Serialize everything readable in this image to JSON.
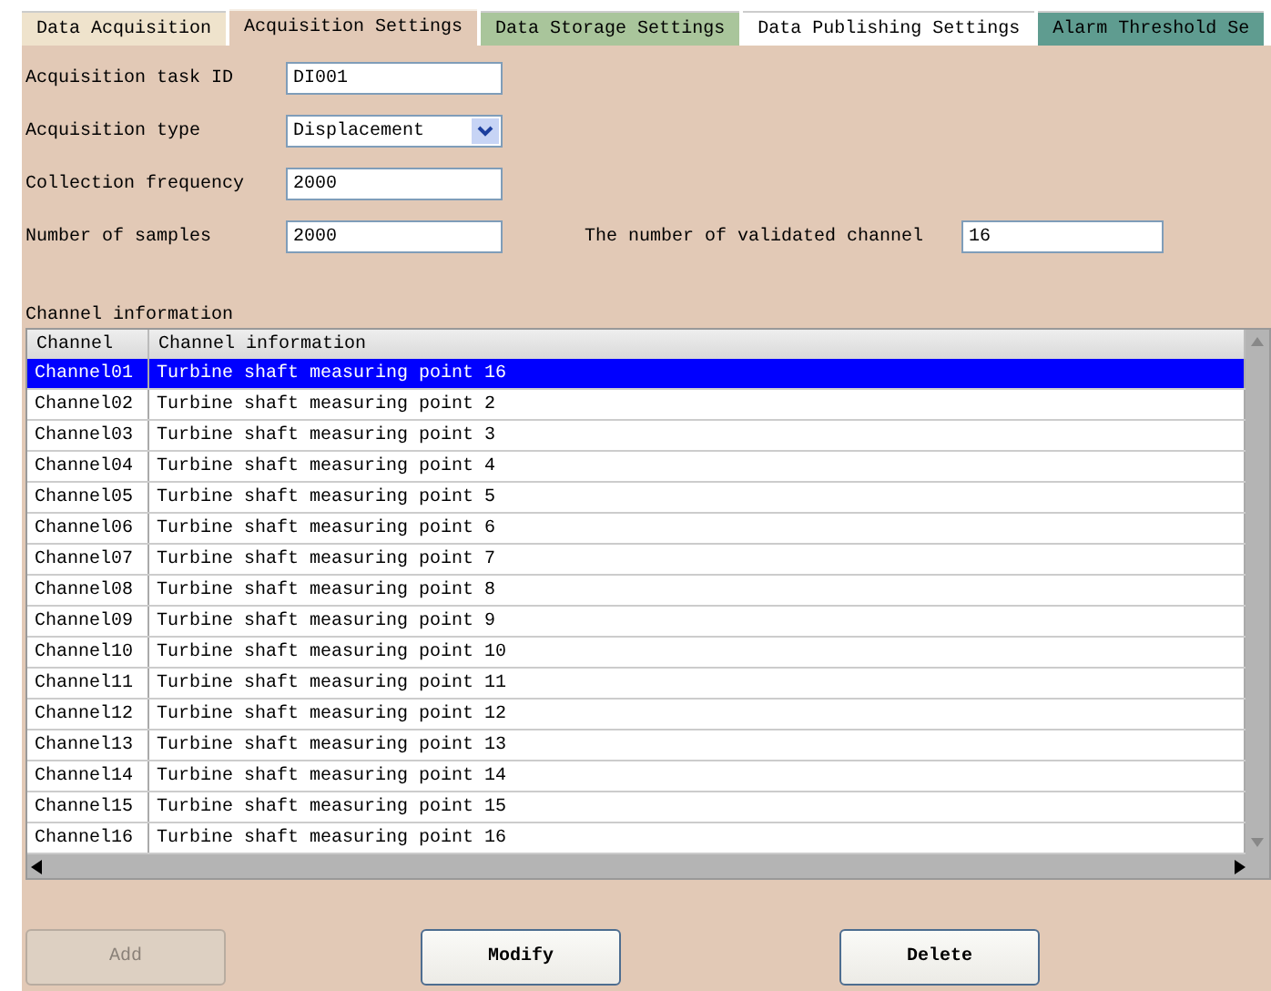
{
  "tabs": [
    {
      "label": "Data Acquisition",
      "selected": false,
      "color": "#efe3cc"
    },
    {
      "label": "Acquisition Settings",
      "selected": true,
      "color": "#e2c9b6"
    },
    {
      "label": "Data Storage Settings",
      "selected": false,
      "color": "#a9c59b"
    },
    {
      "label": "Data Publishing Settings",
      "selected": false,
      "color": "#ffffff"
    },
    {
      "label": "Alarm Threshold Se",
      "selected": false,
      "color": "#5f9c90"
    }
  ],
  "form": {
    "task_id": {
      "label": "Acquisition task ID",
      "value": "DI001"
    },
    "type": {
      "label": "Acquisition type",
      "value": "Displacement"
    },
    "frequency": {
      "label": "Collection frequency",
      "value": "2000"
    },
    "samples": {
      "label": "Number of samples",
      "value": "2000"
    },
    "validated": {
      "label": "The number of validated channel",
      "value": "16"
    }
  },
  "table": {
    "title": "Channel information",
    "columns": [
      "Channel",
      "Channel information"
    ],
    "rows": [
      {
        "channel": "Channel01",
        "info": "Turbine shaft measuring point 16",
        "selected": true
      },
      {
        "channel": "Channel02",
        "info": "Turbine shaft measuring point 2",
        "selected": false
      },
      {
        "channel": "Channel03",
        "info": "Turbine shaft measuring point 3",
        "selected": false
      },
      {
        "channel": "Channel04",
        "info": "Turbine shaft measuring point 4",
        "selected": false
      },
      {
        "channel": "Channel05",
        "info": "Turbine shaft measuring point 5",
        "selected": false
      },
      {
        "channel": "Channel06",
        "info": "Turbine shaft measuring point 6",
        "selected": false
      },
      {
        "channel": "Channel07",
        "info": "Turbine shaft measuring point 7",
        "selected": false
      },
      {
        "channel": "Channel08",
        "info": "Turbine shaft measuring point 8",
        "selected": false
      },
      {
        "channel": "Channel09",
        "info": "Turbine shaft measuring point 9",
        "selected": false
      },
      {
        "channel": "Channel10",
        "info": "Turbine shaft measuring point 10",
        "selected": false
      },
      {
        "channel": "Channel11",
        "info": "Turbine shaft measuring point 11",
        "selected": false
      },
      {
        "channel": "Channel12",
        "info": "Turbine shaft measuring point 12",
        "selected": false
      },
      {
        "channel": "Channel13",
        "info": "Turbine shaft measuring point 13",
        "selected": false
      },
      {
        "channel": "Channel14",
        "info": "Turbine shaft measuring point 14",
        "selected": false
      },
      {
        "channel": "Channel15",
        "info": "Turbine shaft measuring point 15",
        "selected": false
      },
      {
        "channel": "Channel16",
        "info": "Turbine shaft measuring point 16",
        "selected": false
      }
    ]
  },
  "buttons": [
    {
      "label": "Add",
      "disabled": true
    },
    {
      "label": "Modify",
      "disabled": false
    },
    {
      "label": "Delete",
      "disabled": false
    }
  ]
}
